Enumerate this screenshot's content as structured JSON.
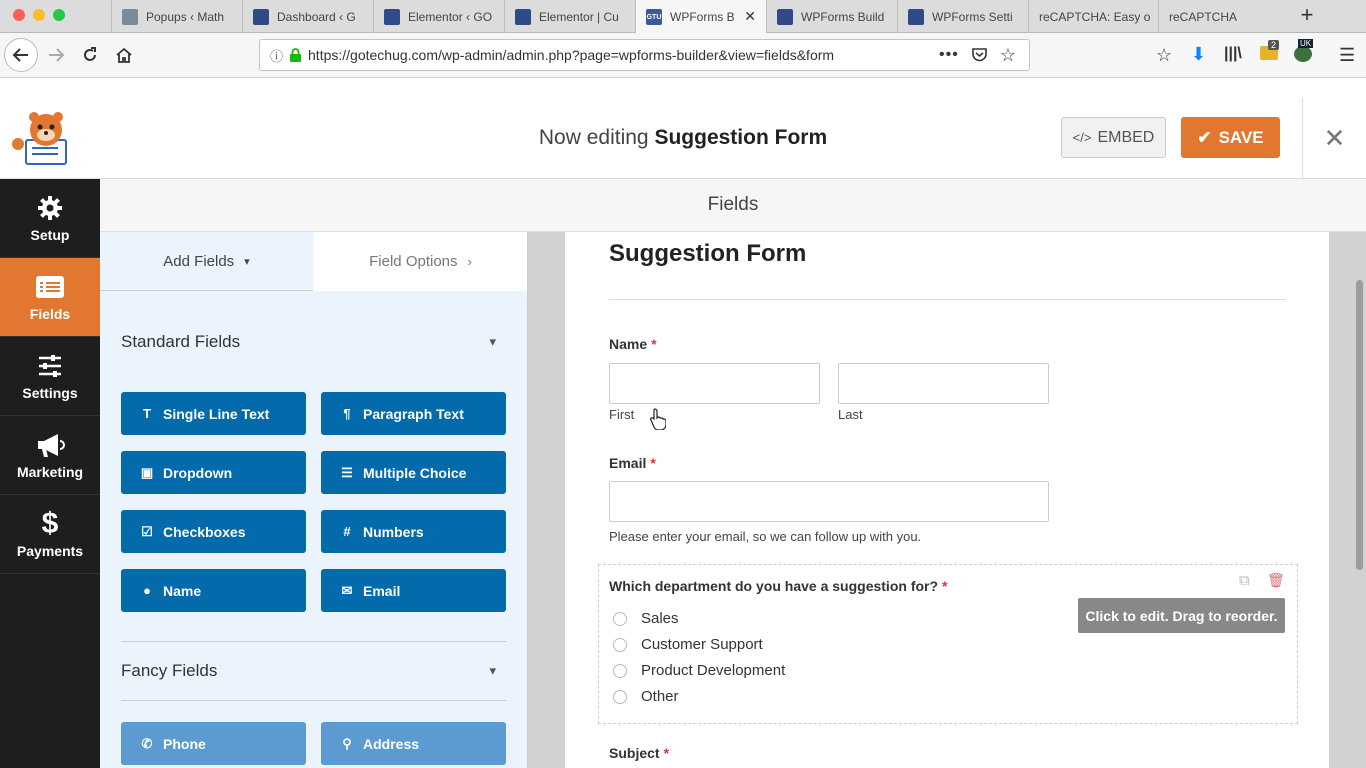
{
  "browser": {
    "tabs": [
      {
        "label": "Popups ‹ Math",
        "fav_color": "#7b8a99",
        "fav_text": ""
      },
      {
        "label": "Dashboard ‹ G",
        "fav_color": "#2f4a87",
        "fav_text": ""
      },
      {
        "label": "Elementor ‹ GO",
        "fav_color": "#2f4a87",
        "fav_text": ""
      },
      {
        "label": "Elementor | Cu",
        "fav_color": "#2f4a87",
        "fav_text": ""
      },
      {
        "label": "WPForms B",
        "fav_color": "#3a5a9a",
        "fav_text": "GTU",
        "active": true
      },
      {
        "label": "WPForms Build",
        "fav_color": "#2f4a87",
        "fav_text": ""
      },
      {
        "label": "WPForms Setti",
        "fav_color": "#2f4a87",
        "fav_text": ""
      },
      {
        "label": "reCAPTCHA: Easy o",
        "fav_color": "",
        "fav_text": ""
      },
      {
        "label": "reCAPTCHA",
        "fav_color": "",
        "fav_text": ""
      }
    ],
    "url": "https://gotechug.com/wp-admin/admin.php?page=wpforms-builder&view=fields&form",
    "download_badge": "2",
    "ext_badge": "UK"
  },
  "header": {
    "editing_prefix": "Now editing",
    "form_name": "Suggestion Form",
    "embed_label": "EMBED",
    "save_label": "SAVE",
    "close_glyph": "✕"
  },
  "sidebar": {
    "items": [
      {
        "label": "Setup",
        "icon": "gear-icon"
      },
      {
        "label": "Fields",
        "icon": "list-icon",
        "active": true
      },
      {
        "label": "Settings",
        "icon": "sliders-icon"
      },
      {
        "label": "Marketing",
        "icon": "megaphone-icon"
      },
      {
        "label": "Payments",
        "icon": "dollar-icon"
      }
    ]
  },
  "fields_bar": {
    "title": "Fields"
  },
  "panel": {
    "tab_add": "Add Fields",
    "tab_options": "Field Options",
    "standard_title": "Standard Fields",
    "standard": [
      {
        "label": "Single Line Text",
        "glyph": "T"
      },
      {
        "label": "Paragraph Text",
        "glyph": "¶"
      },
      {
        "label": "Dropdown",
        "glyph": "▣"
      },
      {
        "label": "Multiple Choice",
        "glyph": "☰"
      },
      {
        "label": "Checkboxes",
        "glyph": "☑"
      },
      {
        "label": "Numbers",
        "glyph": "#"
      },
      {
        "label": "Name",
        "glyph": "●"
      },
      {
        "label": "Email",
        "glyph": "✉"
      }
    ],
    "fancy_title": "Fancy Fields",
    "fancy": [
      {
        "label": "Phone",
        "glyph": "✆"
      },
      {
        "label": "Address",
        "glyph": "⚲"
      }
    ]
  },
  "form": {
    "title": "Suggestion Form",
    "name_label": "Name",
    "first_label": "First",
    "last_label": "Last",
    "email_label": "Email",
    "email_help": "Please enter your email, so we can follow up with you.",
    "dept_label": "Which department do you have a suggestion for?",
    "options": [
      "Sales",
      "Customer Support",
      "Product Development",
      "Other"
    ],
    "tooltip": "Click to edit. Drag to reorder.",
    "subject_label": "Subject",
    "required_mark": "*"
  },
  "colors": {
    "accent": "#e27730",
    "field_button": "#036aab",
    "field_button_light": "#5b9bd1",
    "nav_bg": "#1e1e1e"
  }
}
